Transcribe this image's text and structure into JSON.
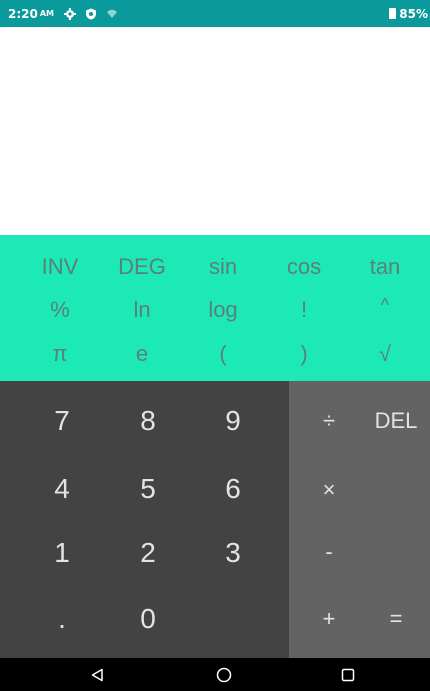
{
  "status_bar": {
    "time": "2:20",
    "ampm": "AM",
    "battery": "85%",
    "icons": [
      "settings-gear-icon",
      "shield-icon",
      "wifi-icon",
      "battery-icon"
    ]
  },
  "display": {
    "formula": "",
    "result": ""
  },
  "scientific_keys": [
    [
      "INV",
      "DEG",
      "sin",
      "cos",
      "tan"
    ],
    [
      "%",
      "ln",
      "log",
      "!",
      "^"
    ],
    [
      "π",
      "e",
      "(",
      ")",
      "√"
    ]
  ],
  "number_keys": [
    [
      "7",
      "8",
      "9"
    ],
    [
      "4",
      "5",
      "6"
    ],
    [
      "1",
      "2",
      "3"
    ],
    [
      ".",
      "0",
      ""
    ]
  ],
  "operator_keys": {
    "divide": "÷",
    "delete": "DEL",
    "multiply": "×",
    "minus": "-",
    "plus": "+",
    "equals": "="
  },
  "nav_bar": {
    "icons": [
      "back-triangle-icon",
      "home-circle-icon",
      "recents-square-icon"
    ]
  },
  "colors": {
    "status_bar": "#0b9a9c",
    "scientific_pad": "#1de9b6",
    "scientific_text": "#5b8077",
    "number_pad": "#434343",
    "operator_pad": "#636363",
    "key_text": "#e3e3e3",
    "nav_bar": "#000000"
  }
}
